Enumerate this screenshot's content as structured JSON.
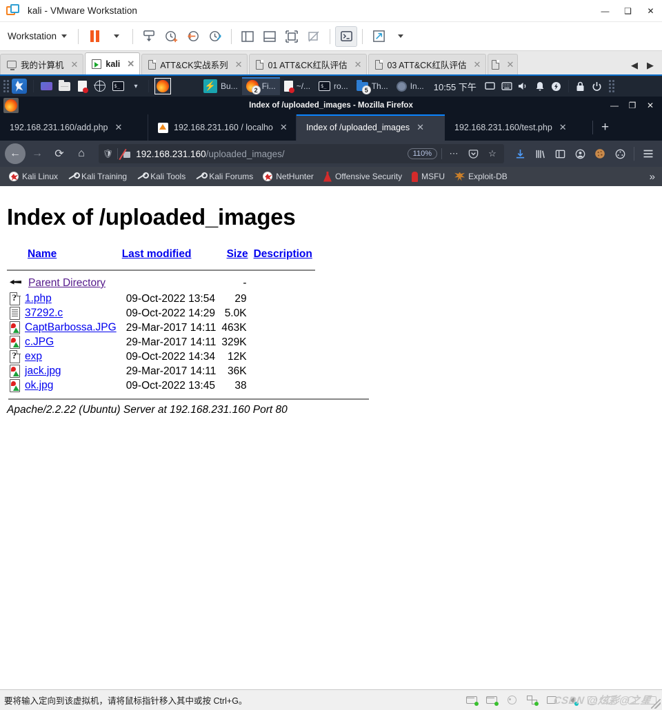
{
  "vmware": {
    "title": "kali - VMware Workstation",
    "window_controls": {
      "minimize": "—",
      "maximize": "❑",
      "close": "✕"
    },
    "menu": {
      "workstation_label": "Workstation"
    },
    "toolbar_icons": [
      "pause-icon",
      "pause-dropdown-icon",
      "snapshot-icon",
      "take-snapshot-icon",
      "revert-snapshot-icon",
      "snapshot-manager-icon",
      "show-sidebar-icon",
      "show-console-view-icon",
      "full-screen-icon",
      "unity-mode-icon",
      "send-ctrl-alt-del-icon",
      "stretch-guest-icon",
      "stretch-dropdown-icon"
    ],
    "tabs": [
      {
        "label": "我的计算机",
        "icon": "monitor-icon",
        "selected": false
      },
      {
        "label": "kali",
        "icon": "vm-running-icon",
        "selected": true
      },
      {
        "label": "ATT&CK实战系列",
        "icon": "folder-doc-icon",
        "selected": false
      },
      {
        "label": "01 ATT&CK红队评估",
        "icon": "folder-doc-icon",
        "selected": false
      },
      {
        "label": "03 ATT&CK红队评估",
        "icon": "folder-doc-icon",
        "selected": false
      },
      {
        "label": "",
        "icon": "folder-doc-icon",
        "selected": false
      }
    ],
    "tab_scroll": {
      "left": "◀",
      "right": "▶"
    },
    "statusbar": {
      "message": "要将输入定向到该虚拟机，请将鼠标指针移入其中或按 Ctrl+G。",
      "device_icons": [
        "hard-disk-icon",
        "hard-disk-2-icon",
        "cd-drive-icon",
        "network-adapter-icon",
        "printer-icon",
        "sound-card-icon",
        "usb-icon",
        "display-icon",
        "shared-folder-icon"
      ],
      "watermark": "CSDN @炫彩@之星"
    }
  },
  "kali_panel": {
    "launchers": [
      "kali-menu-icon",
      "workspace-icon",
      "file-manager-icon",
      "text-editor-icon",
      "web-browser-icon",
      "terminal-icon",
      "apps-dropdown-icon"
    ],
    "pinned": {
      "label": "firefox-icon"
    },
    "windows": [
      {
        "label": "Bu...",
        "icon": "burp-icon",
        "active": false,
        "badge": ""
      },
      {
        "label": "Fi...",
        "icon": "firefox-icon",
        "active": true,
        "badge": "2"
      },
      {
        "label": "~/...",
        "icon": "document-icon",
        "active": false,
        "badge": ""
      },
      {
        "label": "ro...",
        "icon": "terminal-icon",
        "active": false,
        "badge": ""
      },
      {
        "label": "Th...",
        "icon": "thunar-icon",
        "active": false,
        "badge": "5"
      },
      {
        "label": "In...",
        "icon": "chromium-icon",
        "active": false,
        "badge": ""
      }
    ],
    "clock": "10:55 下午",
    "tray": [
      "display-icon",
      "keyboard-icon",
      "volume-icon",
      "notification-icon",
      "power-icon",
      "lock-icon",
      "logout-icon",
      "grip-icon"
    ]
  },
  "firefox": {
    "window_title": "Index of /uploaded_images - Mozilla Firefox",
    "window_controls": {
      "minimize": "—",
      "maximize": "❐",
      "close": "✕"
    },
    "tabs": [
      {
        "label": "192.168.231.160/add.php",
        "favicon": "none",
        "selected": false
      },
      {
        "label": "192.168.231.160 / localho",
        "favicon": "phpmyadmin-icon",
        "selected": false
      },
      {
        "label": "Index of /uploaded_images",
        "favicon": "none",
        "selected": true
      },
      {
        "label": "192.168.231.160/test.php",
        "favicon": "none",
        "selected": false
      }
    ],
    "new_tab_label": "+",
    "nav": {
      "back": "←",
      "forward": "→",
      "reload": "⟳",
      "home": "⌂"
    },
    "urlbar": {
      "host": "192.168.231.160",
      "path": "/uploaded_images/",
      "zoom": "110%",
      "identity_icon": "shield-icon",
      "insecure_icon": "lock-crossed-icon",
      "page_actions": "⋯",
      "pocket": "pocket-icon",
      "bookmark_star": "☆"
    },
    "toolbar_right": [
      "downloads-icon",
      "library-icon",
      "sidebar-icon",
      "account-icon",
      "cookie-icon",
      "container-icon",
      "menu-icon"
    ],
    "bookmarks": [
      {
        "label": "Kali Linux",
        "icon": "kali-dragon-icon"
      },
      {
        "label": "Kali Training",
        "icon": "wrench-icon"
      },
      {
        "label": "Kali Tools",
        "icon": "wrench-icon"
      },
      {
        "label": "Kali Forums",
        "icon": "wrench-icon"
      },
      {
        "label": "NetHunter",
        "icon": "kali-dragon-icon"
      },
      {
        "label": "Offensive Security",
        "icon": "offsec-icon"
      },
      {
        "label": "MSFU",
        "icon": "metasploit-icon"
      },
      {
        "label": "Exploit-DB",
        "icon": "spider-icon"
      }
    ],
    "bookmarks_overflow": "»"
  },
  "page": {
    "heading": "Index of /uploaded_images",
    "columns": {
      "name": "Name",
      "modified": "Last modified",
      "size": "Size",
      "description": "Description"
    },
    "rows": [
      {
        "icon": "parent-directory-icon",
        "name": "Parent Directory",
        "modified": "",
        "size": "-",
        "description": "",
        "visited": true
      },
      {
        "icon": "unknown-file-icon",
        "name": "1.php",
        "modified": "09-Oct-2022 13:54",
        "size": "29",
        "description": "",
        "visited": false
      },
      {
        "icon": "text-file-icon",
        "name": "37292.c",
        "modified": "09-Oct-2022 14:29",
        "size": "5.0K",
        "description": "",
        "visited": false
      },
      {
        "icon": "image-file-icon",
        "name": "CaptBarbossa.JPG",
        "modified": "29-Mar-2017 14:11",
        "size": "463K",
        "description": "",
        "visited": false
      },
      {
        "icon": "image-file-icon",
        "name": "c.JPG",
        "modified": "29-Mar-2017 14:11",
        "size": "329K",
        "description": "",
        "visited": false
      },
      {
        "icon": "unknown-file-icon",
        "name": "exp",
        "modified": "09-Oct-2022 14:34",
        "size": "12K",
        "description": "",
        "visited": false
      },
      {
        "icon": "image-file-icon",
        "name": "jack.jpg",
        "modified": "29-Mar-2017 14:11",
        "size": "36K",
        "description": "",
        "visited": false
      },
      {
        "icon": "image-file-icon",
        "name": "ok.jpg",
        "modified": "09-Oct-2022 13:45",
        "size": "38",
        "description": "",
        "visited": false
      }
    ],
    "server_signature": "Apache/2.2.22 (Ubuntu) Server at 192.168.231.160 Port 80"
  },
  "colors": {
    "vmware_accent": "#0b6ecb",
    "firefox_tab_accent": "#0a84ff",
    "link": "#0000ee",
    "link_visited": "#551a8b",
    "panel_bg": "#1f2733",
    "nav_bg": "#343a46"
  }
}
